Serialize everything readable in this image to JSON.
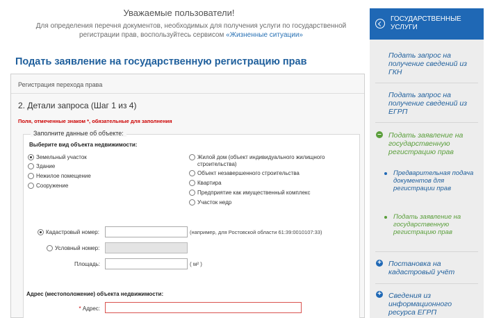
{
  "notice": {
    "title": "Уважаемые пользователи!",
    "text": "Для определения перечня документов, необходимых для получения услуги по государственной регистрации прав, воспользуйтесь сервисом",
    "link": "«Жизненные ситуации»"
  },
  "page_title": "Подать заявление на государственную регистрацию прав",
  "form": {
    "panel_header": "Регистрация перехода права",
    "step_title": "2. Детали запроса (Шаг 1 из 4)",
    "required_note": "Поля, отмеченные знаком *, обязательные для заполнения",
    "legend": "Заполните данные об объекте:",
    "property_type_label": "Выберите вид объекта недвижимости:",
    "property_types_left": [
      {
        "label": "Земельный участок",
        "checked": true
      },
      {
        "label": "Здание",
        "checked": false
      },
      {
        "label": "Нежилое помещение",
        "checked": false
      },
      {
        "label": "Сооружение",
        "checked": false
      }
    ],
    "property_types_right": [
      {
        "label": "Жилой дом (объект индивидуального жилищного строительства)",
        "checked": false
      },
      {
        "label": "Объект незавершенного строительства",
        "checked": false
      },
      {
        "label": "Квартира",
        "checked": false
      },
      {
        "label": "Предприятие как имущественный комплекс",
        "checked": false
      },
      {
        "label": "Участок недр",
        "checked": false
      }
    ],
    "cadastral_label": "Кадастровый номер:",
    "cadastral_value": "",
    "cadastral_hint": "(например, для Ростовской области 61:39:0010107:33)",
    "conditional_label": "Условный номер:",
    "area_label": "Площадь:",
    "area_unit": "( м² )",
    "address_section_label": "Адрес (местоположение) объекта недвижимости:",
    "address_required_mark": "*",
    "address_label": "Адрес:",
    "address_value": ""
  },
  "sidebar": {
    "header": "ГОСУДАРСТВЕННЫЕ УСЛУГИ",
    "items": [
      {
        "label": "Подать запрос на получение сведений из ГКН",
        "icon": "none"
      },
      {
        "label": "Подать запрос на получение сведений из ЕГРП",
        "icon": "none"
      },
      {
        "label": "Подать заявление на государственную регистрацию прав",
        "icon": "minus-circle-icon",
        "active": true
      },
      {
        "label": "Предварительная подача документов для регистрации прав",
        "icon": "dot-icon",
        "sub": true
      },
      {
        "label": "Подать заявление на государственную регистрацию прав",
        "icon": "dot-icon",
        "sub": true,
        "active": true
      },
      {
        "label": "Постановка на кадастровый учёт",
        "icon": "plus-circle-icon"
      },
      {
        "label": "Сведения из информационного ресурса ЕГРП",
        "icon": "plus-circle-icon"
      }
    ]
  },
  "colors": {
    "brand_blue": "#1f68b5",
    "active_green": "#5a9e3b",
    "error_red": "#cc0000"
  }
}
